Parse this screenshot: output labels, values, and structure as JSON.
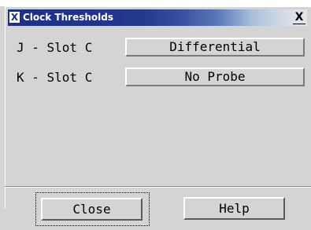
{
  "window": {
    "title": "Clock Thresholds",
    "title_icon_glyph": "X",
    "close_glyph": "X",
    "title_color_start": "#1d2f86",
    "title_color_end": "#e4e6ea"
  },
  "rows": [
    {
      "label": "J - Slot C",
      "value": "Differential"
    },
    {
      "label": "K - Slot C",
      "value": "No Probe"
    }
  ],
  "buttons": {
    "close_label": "Close",
    "help_label": "Help"
  }
}
